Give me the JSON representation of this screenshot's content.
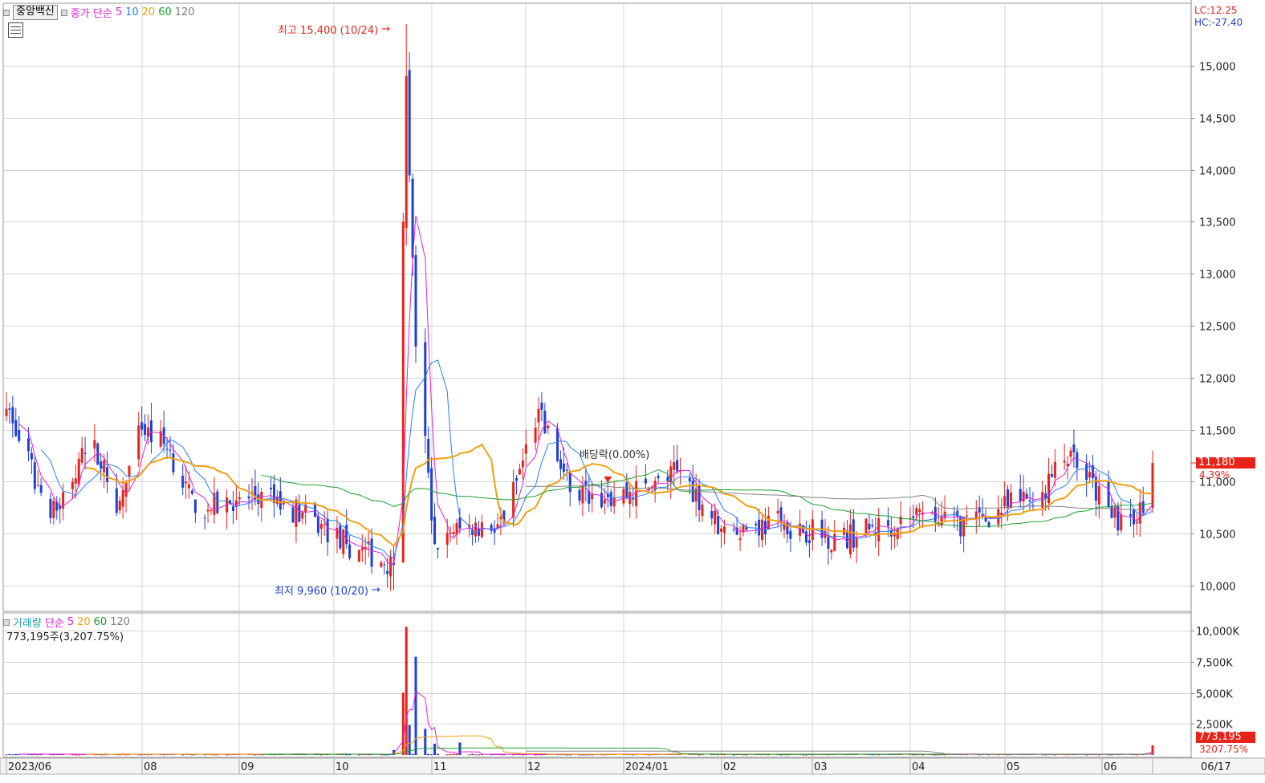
{
  "header": {
    "stock_name": "중앙백신",
    "price_legend_label": "종가 단순",
    "ma_periods": [
      "5",
      "10",
      "20",
      "60",
      "120"
    ],
    "lc_text": "LC:12.25",
    "hc_text": "HC:-27.40"
  },
  "volume_header": {
    "label": "거래량",
    "ma_label": "단순",
    "ma_periods": [
      "5",
      "20",
      "60",
      "120"
    ],
    "summary": "773,195주(3,207.75%)"
  },
  "annotations": {
    "high_label": "최고 15,400 (10/24)",
    "low_label": "최저 9,960 (10/20)",
    "dividend_label": "배당락(0.00%)"
  },
  "current": {
    "price_badge": "11,180",
    "change_pct": "4.39%",
    "volume_badge": "773,195",
    "volume_pct": "3207.75%"
  },
  "colors": {
    "up": "#e8231a",
    "down": "#1f3fd6",
    "ma5": "#e020e0",
    "ma10": "#2a7fff",
    "ma20": "#f0a010",
    "ma60": "#1aa02a",
    "ma120": "#808080",
    "grid": "#d4d4d4"
  },
  "chart_data": [
    {
      "type": "candlestick",
      "title": "중앙백신",
      "ylim": [
        9800,
        15400
      ],
      "y_ticks": [
        "10,000",
        "10,500",
        "11,000",
        "11,500",
        "12,000",
        "12,500",
        "13,000",
        "13,500",
        "14,000",
        "14,500",
        "15,000"
      ],
      "x_ticks": [
        "2023/06",
        "08",
        "09",
        "10",
        "11",
        "12",
        "2024/01",
        "02",
        "03",
        "04",
        "05",
        "06",
        "06/17"
      ],
      "x_range": [
        "2023-06-19",
        "2024-06-17"
      ],
      "high": {
        "value": 15400,
        "date": "10/24"
      },
      "low": {
        "value": 9960,
        "date": "10/20"
      },
      "last_close": 11180,
      "change_pct": 4.39,
      "key_points": [
        {
          "date": "2023-06-19",
          "close": 11700
        },
        {
          "date": "2023-07-03",
          "close": 10650
        },
        {
          "date": "2023-07-17",
          "close": 11400
        },
        {
          "date": "2023-07-24",
          "close": 10700
        },
        {
          "date": "2023-08-01",
          "close": 11500
        },
        {
          "date": "2023-08-10",
          "close": 11300
        },
        {
          "date": "2023-08-18",
          "close": 10700
        },
        {
          "date": "2023-09-01",
          "close": 10850
        },
        {
          "date": "2023-09-15",
          "close": 10800
        },
        {
          "date": "2023-10-05",
          "close": 10400
        },
        {
          "date": "2023-10-20",
          "close": 10200
        },
        {
          "date": "2023-10-23",
          "close": 13500
        },
        {
          "date": "2023-10-24",
          "close": 14900
        },
        {
          "date": "2023-10-27",
          "close": 12300
        },
        {
          "date": "2023-11-02",
          "close": 10400
        },
        {
          "date": "2023-11-10",
          "close": 10550
        },
        {
          "date": "2023-11-24",
          "close": 10600
        },
        {
          "date": "2023-12-05",
          "close": 11700
        },
        {
          "date": "2023-12-15",
          "close": 10900
        },
        {
          "date": "2023-12-27",
          "close": 10850
        },
        {
          "date": "2024-01-10",
          "close": 10950
        },
        {
          "date": "2024-01-19",
          "close": 11100
        },
        {
          "date": "2024-02-01",
          "close": 10550
        },
        {
          "date": "2024-02-20",
          "close": 10600
        },
        {
          "date": "2024-03-10",
          "close": 10450
        },
        {
          "date": "2024-04-01",
          "close": 10650
        },
        {
          "date": "2024-04-20",
          "close": 10600
        },
        {
          "date": "2024-05-13",
          "close": 10900
        },
        {
          "date": "2024-05-22",
          "close": 11300
        },
        {
          "date": "2024-06-04",
          "close": 10650
        },
        {
          "date": "2024-06-14",
          "close": 10700
        },
        {
          "date": "2024-06-17",
          "close": 11180
        }
      ]
    },
    {
      "type": "bar",
      "title": "거래량",
      "ylim": [
        0,
        11000000
      ],
      "y_ticks": [
        "2,500K",
        "5,000K",
        "7,500K",
        "10,000K"
      ],
      "last_volume": 773195,
      "last_volume_pct": 3207.75,
      "key_points": [
        {
          "date": "2023-10-20",
          "volume": 400000
        },
        {
          "date": "2023-10-23",
          "volume": 5000000
        },
        {
          "date": "2023-10-24",
          "volume": 10300000
        },
        {
          "date": "2023-10-25",
          "volume": 2400000
        },
        {
          "date": "2023-10-27",
          "volume": 7900000
        },
        {
          "date": "2023-10-30",
          "volume": 2100000
        },
        {
          "date": "2023-11-02",
          "volume": 900000
        },
        {
          "date": "2023-11-10",
          "volume": 1000000
        },
        {
          "date": "2024-06-17",
          "volume": 773195
        }
      ]
    }
  ]
}
